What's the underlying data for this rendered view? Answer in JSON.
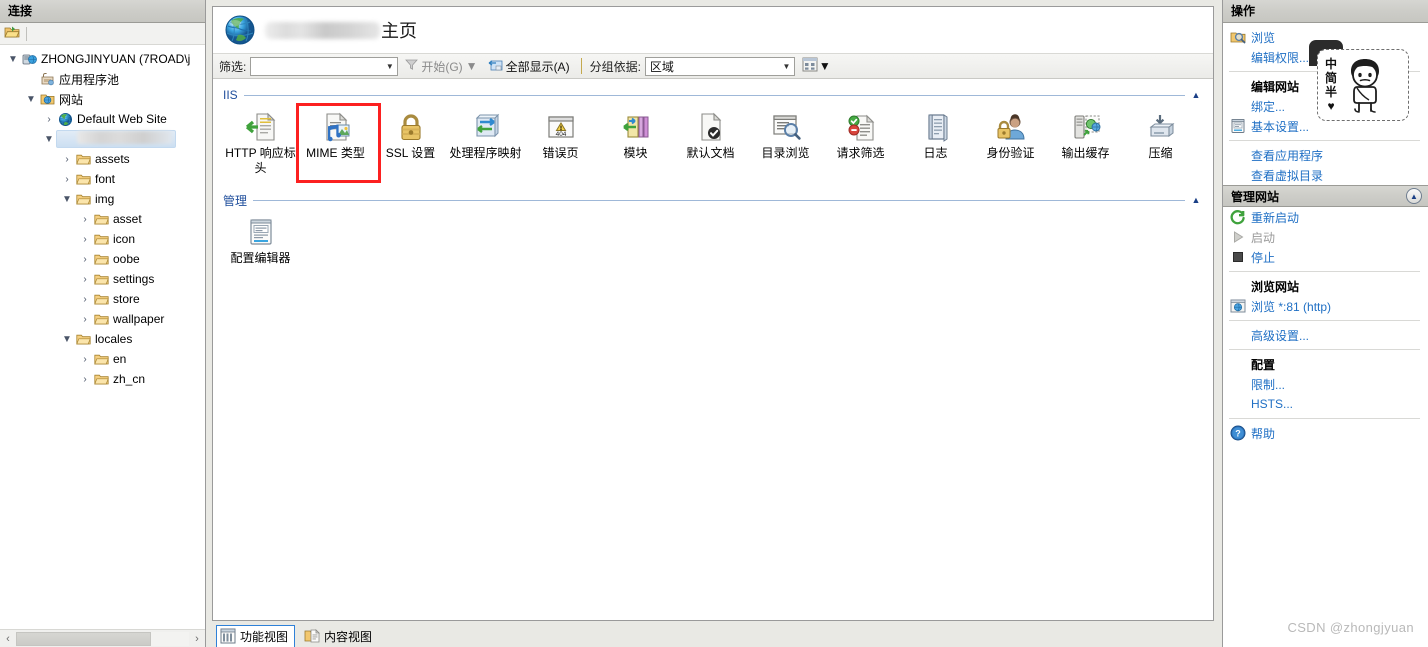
{
  "tree_panel": {
    "header": "连接",
    "toolbar": {
      "connect_icon": "open-folder-icon"
    },
    "nodes": [
      {
        "label": "ZHONGJINYUAN (7ROAD\\j",
        "icon": "server-icon",
        "depth": 0,
        "expander": "▼",
        "redacted": false
      },
      {
        "label": "应用程序池",
        "icon": "app-pools-icon",
        "depth": 1,
        "expander": "",
        "redacted": false
      },
      {
        "label": "网站",
        "icon": "sites-folder-icon",
        "depth": 1,
        "expander": "▼",
        "redacted": false
      },
      {
        "label": "Default Web Site",
        "icon": "globe-icon",
        "depth": 2,
        "expander": "›",
        "redacted": false
      },
      {
        "label": "",
        "icon": "globe-icon",
        "depth": 2,
        "expander": "▼",
        "redacted": true,
        "selected": true
      },
      {
        "label": "assets",
        "icon": "folder-icon",
        "depth": 3,
        "expander": "›",
        "redacted": false
      },
      {
        "label": "font",
        "icon": "folder-icon",
        "depth": 3,
        "expander": "›",
        "redacted": false
      },
      {
        "label": "img",
        "icon": "folder-icon",
        "depth": 3,
        "expander": "▼",
        "redacted": false
      },
      {
        "label": "asset",
        "icon": "folder-icon",
        "depth": 4,
        "expander": "›",
        "redacted": false
      },
      {
        "label": "icon",
        "icon": "folder-icon",
        "depth": 4,
        "expander": "›",
        "redacted": false
      },
      {
        "label": "oobe",
        "icon": "folder-icon",
        "depth": 4,
        "expander": "›",
        "redacted": false
      },
      {
        "label": "settings",
        "icon": "folder-icon",
        "depth": 4,
        "expander": "›",
        "redacted": false
      },
      {
        "label": "store",
        "icon": "folder-icon",
        "depth": 4,
        "expander": "›",
        "redacted": false
      },
      {
        "label": "wallpaper",
        "icon": "folder-icon",
        "depth": 4,
        "expander": "›",
        "redacted": false
      },
      {
        "label": "locales",
        "icon": "folder-icon",
        "depth": 3,
        "expander": "▼",
        "redacted": false
      },
      {
        "label": "en",
        "icon": "folder-icon",
        "depth": 4,
        "expander": "›",
        "redacted": false
      },
      {
        "label": "zh_cn",
        "icon": "folder-icon",
        "depth": 4,
        "expander": "›",
        "redacted": false
      }
    ],
    "scrollbar": {
      "left_arrow": "‹",
      "right_arrow": "›"
    }
  },
  "page": {
    "title_suffix": "主页",
    "title_site_redacted": true
  },
  "filter_bar": {
    "filter_label": "筛选:",
    "filter_value": "",
    "filter_placeholder": "",
    "start_button": "开始(G)",
    "show_all_button": "全部显示(A)",
    "group_by_label": "分组依据:",
    "group_by_value": "区域",
    "view_mode_icon": "grid-view-icon"
  },
  "sections": [
    {
      "name": "IIS",
      "items": [
        {
          "label": "HTTP 响应标头",
          "icon": "http-response-headers-icon",
          "highlight": false
        },
        {
          "label": "MIME 类型",
          "icon": "mime-types-icon",
          "highlight": true
        },
        {
          "label": "SSL 设置",
          "icon": "ssl-settings-icon",
          "highlight": false
        },
        {
          "label": "处理程序映射",
          "icon": "handler-mappings-icon",
          "highlight": false
        },
        {
          "label": "错误页",
          "icon": "error-pages-icon",
          "highlight": false
        },
        {
          "label": "模块",
          "icon": "modules-icon",
          "highlight": false
        },
        {
          "label": "默认文档",
          "icon": "default-document-icon",
          "highlight": false
        },
        {
          "label": "目录浏览",
          "icon": "directory-browsing-icon",
          "highlight": false
        },
        {
          "label": "请求筛选",
          "icon": "request-filtering-icon",
          "highlight": false
        },
        {
          "label": "日志",
          "icon": "logging-icon",
          "highlight": false
        },
        {
          "label": "身份验证",
          "icon": "authentication-icon",
          "highlight": false
        },
        {
          "label": "输出缓存",
          "icon": "output-caching-icon",
          "highlight": false
        },
        {
          "label": "压缩",
          "icon": "compression-icon",
          "highlight": false
        }
      ]
    },
    {
      "name": "管理",
      "items": [
        {
          "label": "配置编辑器",
          "icon": "configuration-editor-icon",
          "highlight": false
        }
      ]
    }
  ],
  "view_tabs": [
    {
      "label": "功能视图",
      "icon": "features-view-icon",
      "active": true
    },
    {
      "label": "内容视图",
      "icon": "content-view-icon",
      "active": false
    }
  ],
  "actions_panel": {
    "header": "操作",
    "groups": [
      {
        "title": "",
        "collapsible": false,
        "items": [
          {
            "label": "浏览",
            "icon": "browse-icon",
            "style": "link"
          },
          {
            "label": "编辑权限...",
            "icon": "",
            "style": "link"
          },
          {
            "divider": true
          },
          {
            "label": "编辑网站",
            "icon": "",
            "style": "header"
          },
          {
            "label": "绑定...",
            "icon": "",
            "style": "link"
          },
          {
            "label": "基本设置...",
            "icon": "basic-settings-icon",
            "style": "link"
          },
          {
            "divider": true
          },
          {
            "label": "查看应用程序",
            "icon": "",
            "style": "link"
          },
          {
            "label": "查看虚拟目录",
            "icon": "",
            "style": "link"
          }
        ]
      },
      {
        "title": "管理网站",
        "collapsible": true,
        "items": [
          {
            "label": "重新启动",
            "icon": "restart-icon",
            "style": "link"
          },
          {
            "label": "启动",
            "icon": "start-icon",
            "style": "disabled"
          },
          {
            "label": "停止",
            "icon": "stop-icon",
            "style": "link"
          },
          {
            "divider": true
          },
          {
            "label": "浏览网站",
            "icon": "",
            "style": "header"
          },
          {
            "label": "浏览 *:81 (http)",
            "icon": "browse-site-icon",
            "style": "link"
          },
          {
            "divider": true
          },
          {
            "label": "高级设置...",
            "icon": "",
            "style": "link"
          },
          {
            "divider": true
          },
          {
            "label": "配置",
            "icon": "",
            "style": "header"
          },
          {
            "label": "限制...",
            "icon": "",
            "style": "link"
          },
          {
            "label": "HSTS...",
            "icon": "",
            "style": "link"
          },
          {
            "divider": true
          },
          {
            "label": "帮助",
            "icon": "help-icon",
            "style": "link"
          }
        ]
      }
    ]
  },
  "ime_overlay": {
    "mode_chars": [
      "中",
      "简",
      "半",
      "♥"
    ],
    "character_icon": "ime-mascot-icon"
  },
  "watermark": "CSDN @zhongjyuan",
  "colors": {
    "section_title": "#1f4e9c",
    "link": "#1f6fc4",
    "highlight_box": "#fc2020",
    "panel_header_bg": "#cdcdc8",
    "selection_bg": "#ccdff2"
  }
}
